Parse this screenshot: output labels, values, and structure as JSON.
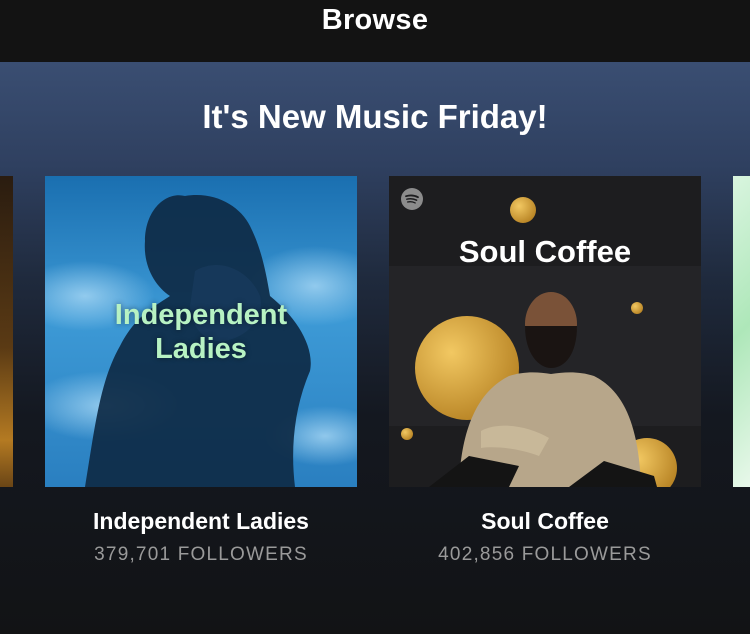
{
  "navbar": {
    "title": "Browse"
  },
  "hero": {
    "title": "It's New Music Friday!"
  },
  "playlists": [
    {
      "cover_text_line1": "Independent",
      "cover_text_line2": "Ladies",
      "title": "Independent Ladies",
      "followers": "379,701 FOLLOWERS"
    },
    {
      "cover_text_line1": "Soul Coffee",
      "title": "Soul Coffee",
      "followers": "402,856 FOLLOWERS",
      "badge_icon": "spotify-icon"
    }
  ],
  "colors": {
    "hero_top": "#3a4e72",
    "independent_ladies_text": "#b7f2c3",
    "followers_text": "#9a9a9a",
    "accent_gold": "#d9a53a"
  }
}
